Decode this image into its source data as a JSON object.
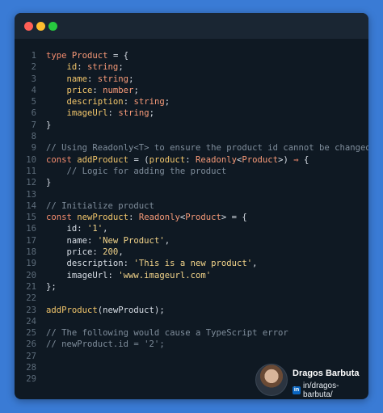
{
  "window": {
    "traffic_lights": [
      "close",
      "minimize",
      "maximize"
    ]
  },
  "code_lines": [
    [
      {
        "t": "type",
        "c": "kw"
      },
      {
        "t": " ",
        "c": "txt"
      },
      {
        "t": "Product",
        "c": "ty"
      },
      {
        "t": " = {",
        "c": "txt"
      }
    ],
    [
      {
        "t": "    ",
        "c": "txt"
      },
      {
        "t": "id",
        "c": "pr"
      },
      {
        "t": ": ",
        "c": "txt"
      },
      {
        "t": "string",
        "c": "ty"
      },
      {
        "t": ";",
        "c": "txt"
      }
    ],
    [
      {
        "t": "    ",
        "c": "txt"
      },
      {
        "t": "name",
        "c": "pr"
      },
      {
        "t": ": ",
        "c": "txt"
      },
      {
        "t": "string",
        "c": "ty"
      },
      {
        "t": ";",
        "c": "txt"
      }
    ],
    [
      {
        "t": "    ",
        "c": "txt"
      },
      {
        "t": "price",
        "c": "pr"
      },
      {
        "t": ": ",
        "c": "txt"
      },
      {
        "t": "number",
        "c": "ty"
      },
      {
        "t": ";",
        "c": "txt"
      }
    ],
    [
      {
        "t": "    ",
        "c": "txt"
      },
      {
        "t": "description",
        "c": "pr"
      },
      {
        "t": ": ",
        "c": "txt"
      },
      {
        "t": "string",
        "c": "ty"
      },
      {
        "t": ";",
        "c": "txt"
      }
    ],
    [
      {
        "t": "    ",
        "c": "txt"
      },
      {
        "t": "imageUrl",
        "c": "pr"
      },
      {
        "t": ": ",
        "c": "txt"
      },
      {
        "t": "string",
        "c": "ty"
      },
      {
        "t": ";",
        "c": "txt"
      }
    ],
    [
      {
        "t": "}",
        "c": "txt"
      }
    ],
    [],
    [
      {
        "t": "// Using Readonly<T> to ensure the product id cannot be changed",
        "c": "cm"
      }
    ],
    [
      {
        "t": "const",
        "c": "kw"
      },
      {
        "t": " ",
        "c": "txt"
      },
      {
        "t": "addProduct",
        "c": "fn"
      },
      {
        "t": " = (",
        "c": "txt"
      },
      {
        "t": "product",
        "c": "pr"
      },
      {
        "t": ": ",
        "c": "txt"
      },
      {
        "t": "Readonly",
        "c": "ty"
      },
      {
        "t": "<",
        "c": "txt"
      },
      {
        "t": "Product",
        "c": "ty"
      },
      {
        "t": ">) ",
        "c": "txt"
      },
      {
        "t": "⇒",
        "c": "kw"
      },
      {
        "t": " {",
        "c": "txt"
      }
    ],
    [
      {
        "t": "    ",
        "c": "txt"
      },
      {
        "t": "// Logic for adding the product",
        "c": "cm"
      }
    ],
    [
      {
        "t": "}",
        "c": "txt"
      }
    ],
    [],
    [
      {
        "t": "// Initialize product",
        "c": "cm"
      }
    ],
    [
      {
        "t": "const",
        "c": "kw"
      },
      {
        "t": " ",
        "c": "txt"
      },
      {
        "t": "newProduct",
        "c": "fn"
      },
      {
        "t": ": ",
        "c": "txt"
      },
      {
        "t": "Readonly",
        "c": "ty"
      },
      {
        "t": "<",
        "c": "txt"
      },
      {
        "t": "Product",
        "c": "ty"
      },
      {
        "t": "> = {",
        "c": "txt"
      }
    ],
    [
      {
        "t": "    id: ",
        "c": "txt"
      },
      {
        "t": "'1'",
        "c": "st"
      },
      {
        "t": ",",
        "c": "txt"
      }
    ],
    [
      {
        "t": "    name: ",
        "c": "txt"
      },
      {
        "t": "'New Product'",
        "c": "st"
      },
      {
        "t": ",",
        "c": "txt"
      }
    ],
    [
      {
        "t": "    price: ",
        "c": "txt"
      },
      {
        "t": "200",
        "c": "nu"
      },
      {
        "t": ",",
        "c": "txt"
      }
    ],
    [
      {
        "t": "    description: ",
        "c": "txt"
      },
      {
        "t": "'This is a new product'",
        "c": "st"
      },
      {
        "t": ",",
        "c": "txt"
      }
    ],
    [
      {
        "t": "    imageUrl: ",
        "c": "txt"
      },
      {
        "t": "'www.imageurl.com'",
        "c": "st"
      }
    ],
    [
      {
        "t": "};",
        "c": "txt"
      }
    ],
    [],
    [
      {
        "t": "addProduct",
        "c": "fn"
      },
      {
        "t": "(newProduct);",
        "c": "txt"
      }
    ],
    [],
    [
      {
        "t": "// The following would cause a TypeScript error",
        "c": "cm"
      }
    ],
    [
      {
        "t": "// newProduct.id = '2';",
        "c": "cm"
      }
    ],
    [],
    [],
    []
  ],
  "author": {
    "name": "Dragos Barbuta",
    "linkedin_badge": "in",
    "handle": "in/dragos-barbuta/"
  },
  "colors": {
    "background": "#3a7bd5",
    "editor": "#0f1923",
    "keyword": "#f58c6e",
    "string": "#f3d48a",
    "comment": "#7f8d9b"
  }
}
